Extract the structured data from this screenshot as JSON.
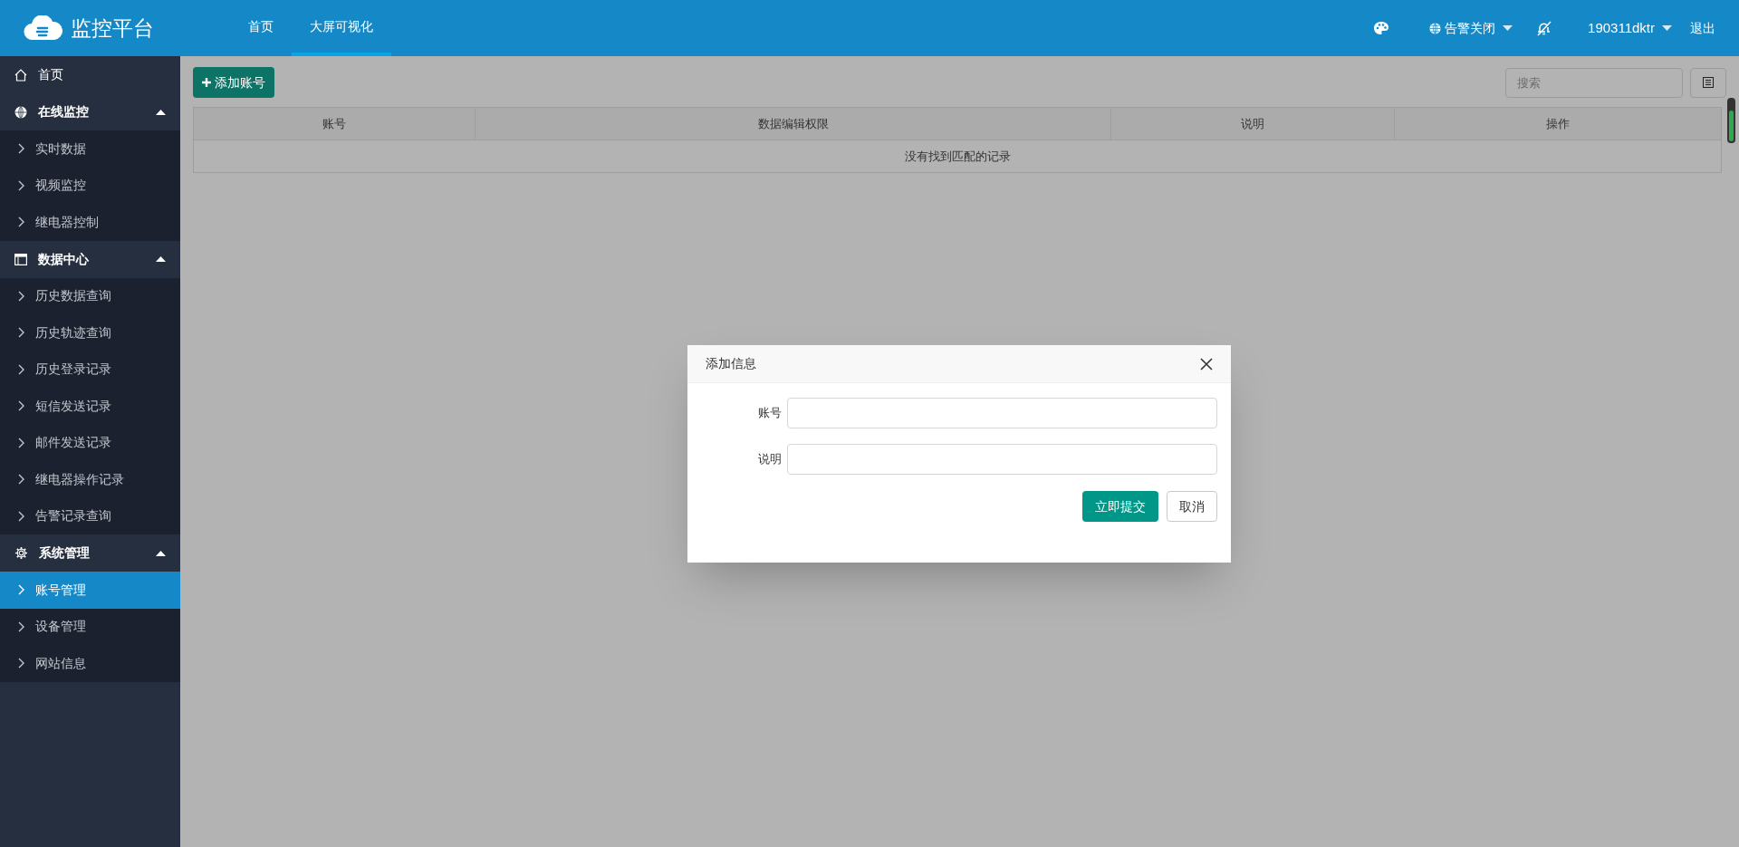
{
  "header": {
    "logo_text": "监控平台",
    "nav": [
      {
        "label": "首页",
        "selected": false
      },
      {
        "label": "大屏可视化",
        "selected": true
      }
    ],
    "alarm": "告警关闭",
    "user": "190311dktr",
    "logout": "退出"
  },
  "sidebar": {
    "items": [
      {
        "kind": "link",
        "label": "首页"
      },
      {
        "kind": "group",
        "label": "在线监控",
        "expanded": true,
        "children": [
          {
            "label": "实时数据",
            "selected": false
          },
          {
            "label": "视频监控",
            "selected": false
          },
          {
            "label": "继电器控制",
            "selected": false
          }
        ]
      },
      {
        "kind": "group",
        "label": "数据中心",
        "expanded": true,
        "children": [
          {
            "label": "历史数据查询",
            "selected": false
          },
          {
            "label": "历史轨迹查询",
            "selected": false
          },
          {
            "label": "历史登录记录",
            "selected": false
          },
          {
            "label": "短信发送记录",
            "selected": false
          },
          {
            "label": "邮件发送记录",
            "selected": false
          },
          {
            "label": "继电器操作记录",
            "selected": false
          },
          {
            "label": "告警记录查询",
            "selected": false
          }
        ]
      },
      {
        "kind": "group",
        "label": "系统管理",
        "expanded": true,
        "children": [
          {
            "label": "账号管理",
            "selected": true
          },
          {
            "label": "设备管理",
            "selected": false
          },
          {
            "label": "网站信息",
            "selected": false
          }
        ]
      }
    ]
  },
  "toolbar": {
    "add_button": "添加账号",
    "search": {
      "placeholder": "搜索"
    }
  },
  "table": {
    "columns": [
      "账号",
      "数据编辑权限",
      "说明",
      "操作"
    ],
    "empty_message": "没有找到匹配的记录"
  },
  "dialog": {
    "title": "添加信息",
    "fields": [
      {
        "label": "账号"
      },
      {
        "label": "说明"
      }
    ],
    "buttons": [
      {
        "label": "立即提交",
        "kind": "primary"
      },
      {
        "label": "取消",
        "kind": "secondary"
      }
    ]
  }
}
